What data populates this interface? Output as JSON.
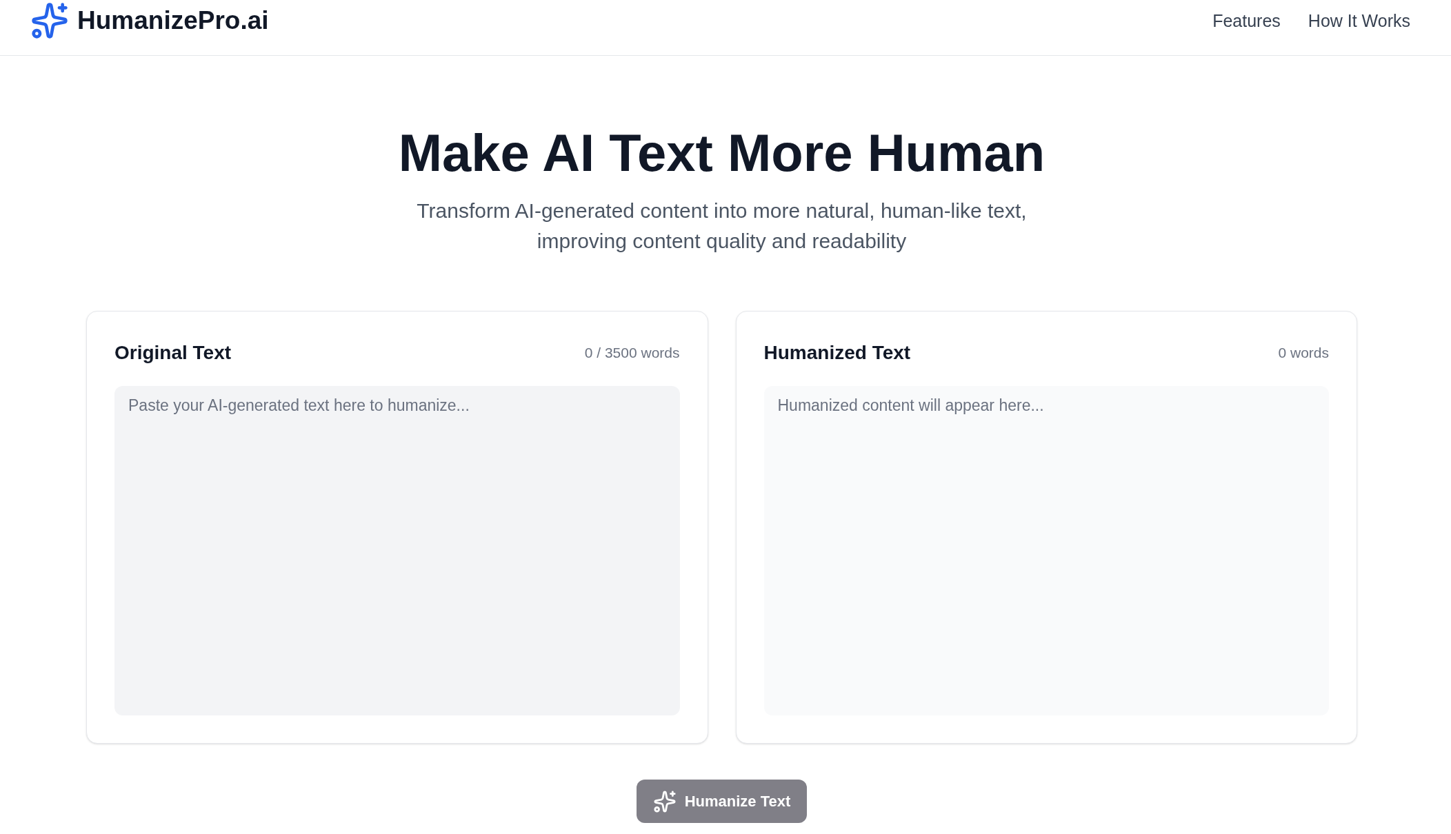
{
  "header": {
    "brand": "HumanizePro.ai",
    "nav": [
      "Features",
      "How It Works"
    ]
  },
  "hero": {
    "title": "Make AI Text More Human",
    "subtitle": "Transform AI-generated content into more natural, human-like text, improving content quality and readability"
  },
  "panels": [
    {
      "kind": "input",
      "title": "Original Text",
      "count": "0 / 3500 words",
      "placeholder": "Paste your AI-generated text here to humanize..."
    },
    {
      "kind": "output",
      "title": "Humanized Text",
      "count": "0 words",
      "placeholder": "Humanized content will appear here..."
    }
  ],
  "action_button": {
    "label": "Humanize Text",
    "disabled": true
  }
}
